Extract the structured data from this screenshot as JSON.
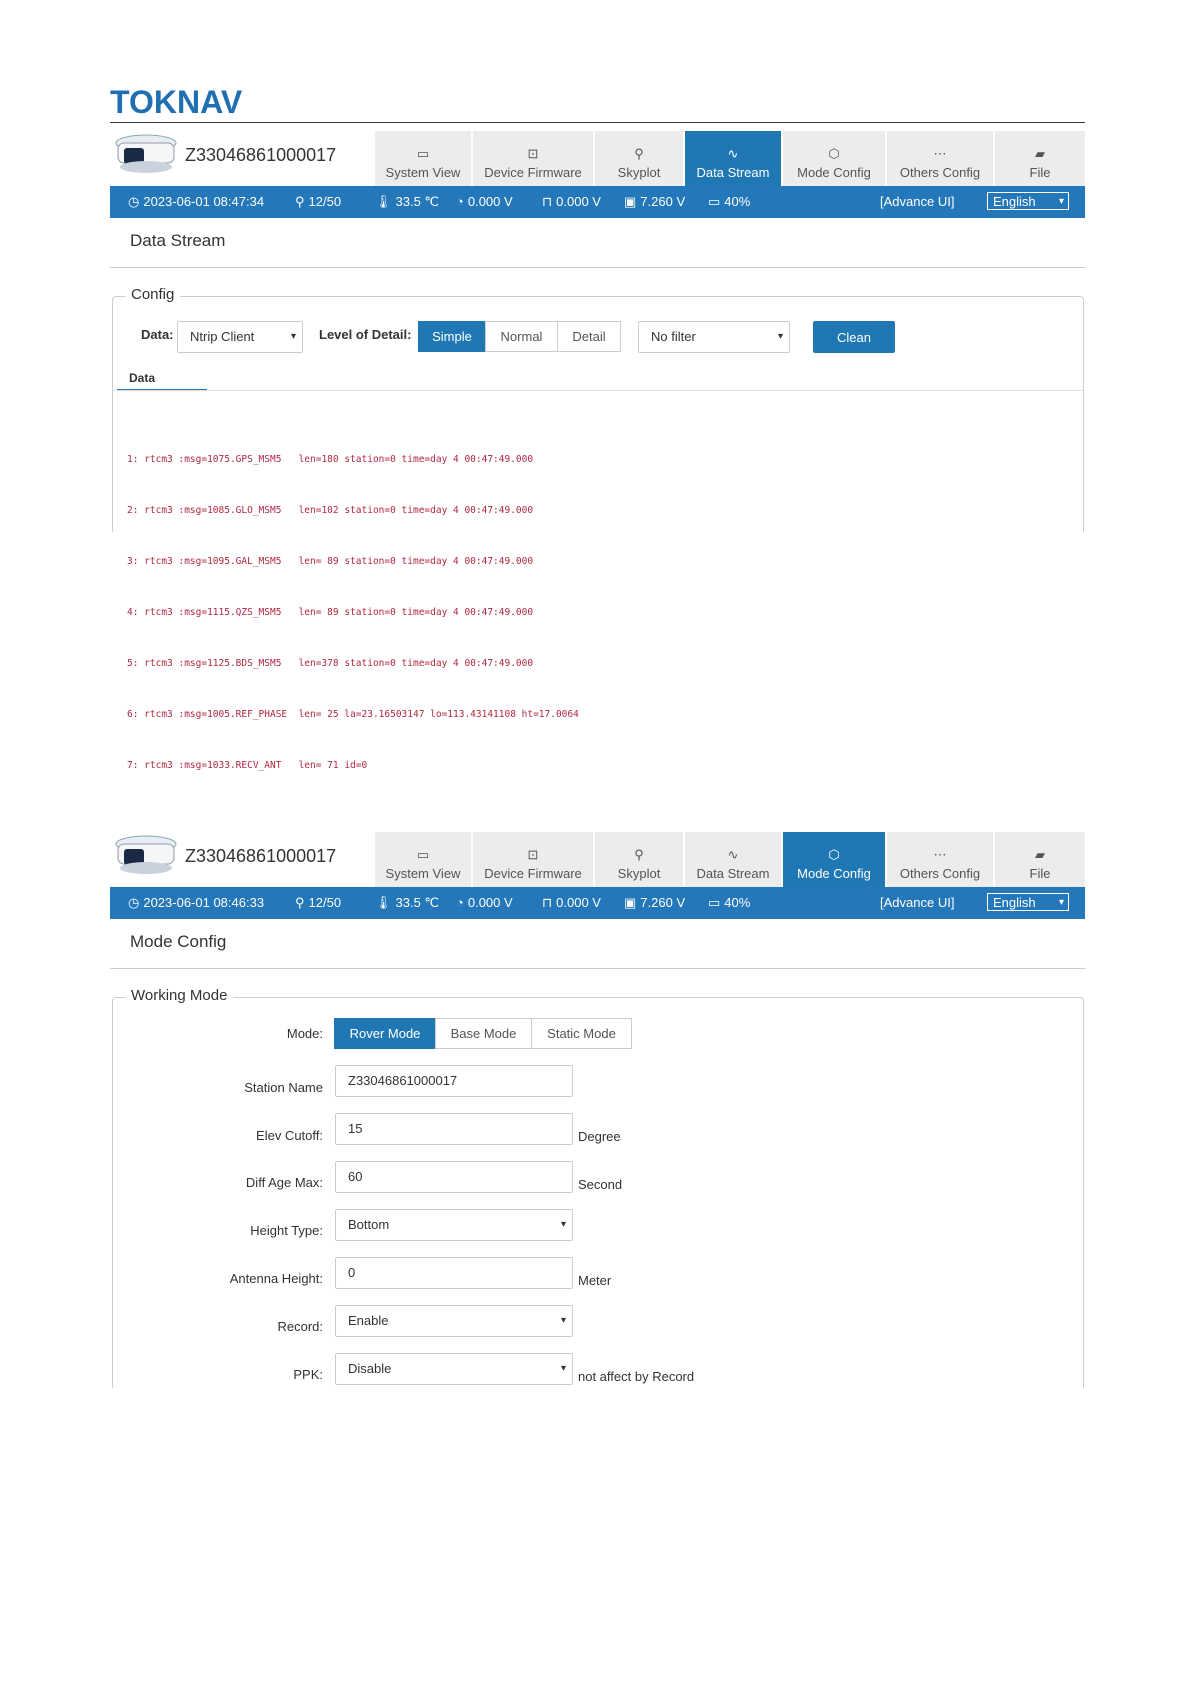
{
  "brand": {
    "logo_text": "TOKNAV"
  },
  "tab_icons": [
    "monitor-icon",
    "chip-icon",
    "satellite-icon",
    "wave-icon",
    "cube-icon",
    "ellipsis-icon",
    "folder-icon"
  ],
  "screens": [
    {
      "serial": "Z33046861000017",
      "tabs": [
        "System View",
        "Device Firmware",
        "Skyplot",
        "Data Stream",
        "Mode Config",
        "Others Config",
        "File"
      ],
      "active_tab": 3,
      "status": {
        "time": "2023-06-01 08:47:34",
        "sats": "12/50",
        "temp": "33.5 ℃",
        "v1": "0.000 V",
        "v2": "0.000 V",
        "v3": "7.260 V",
        "battery": "40%",
        "advance": "[Advance UI]",
        "language": "English"
      },
      "title": "Data Stream",
      "fieldset": "Config",
      "data_label": "Data:",
      "data_value": "Ntrip Client",
      "detail_label": "Level of Detail:",
      "detail_options": [
        "Simple",
        "Normal",
        "Detail"
      ],
      "detail_active": 0,
      "filter_value": "No filter",
      "clean_label": "Clean",
      "subtab": "Data",
      "log": [
        "1: rtcm3 :msg=1075.GPS_MSM5   len=180 station=0 time=day 4 00:47:49.000",
        "2: rtcm3 :msg=1085.GLO_MSM5   len=102 station=0 time=day 4 00:47:49.000",
        "3: rtcm3 :msg=1095.GAL_MSM5   len= 89 station=0 time=day 4 00:47:49.000",
        "4: rtcm3 :msg=1115.QZS_MSM5   len= 89 station=0 time=day 4 00:47:49.000",
        "5: rtcm3 :msg=1125.BDS_MSM5   len=378 station=0 time=day 4 00:47:49.000",
        "6: rtcm3 :msg=1005.REF_PHASE  len= 25 la=23.16503147 lo=113.43141108 ht=17.0064",
        "7: rtcm3 :msg=1033.RECV_ANT   len= 71 id=0"
      ]
    },
    {
      "serial": "Z33046861000017",
      "tabs": [
        "System View",
        "Device Firmware",
        "Skyplot",
        "Data Stream",
        "Mode Config",
        "Others Config",
        "File"
      ],
      "active_tab": 4,
      "status": {
        "time": "2023-06-01 08:46:33",
        "sats": "12/50",
        "temp": "33.5 ℃",
        "v1": "0.000 V",
        "v2": "0.000 V",
        "v3": "7.260 V",
        "battery": "40%",
        "advance": "[Advance UI]",
        "language": "English"
      },
      "title": "Mode Config",
      "fieldset": "Working Mode",
      "mode_label": "Mode:",
      "mode_options": [
        "Rover Mode",
        "Base Mode",
        "Static Mode"
      ],
      "mode_active": 0,
      "fields": [
        {
          "label": "Station Name",
          "value": "Z33046861000017",
          "kind": "input",
          "unit": ""
        },
        {
          "label": "Elev Cutoff:",
          "value": "15",
          "kind": "input",
          "unit": "Degree"
        },
        {
          "label": "Diff Age Max:",
          "value": "60",
          "kind": "input",
          "unit": "Second"
        },
        {
          "label": "Height Type:",
          "value": "Bottom",
          "kind": "select",
          "unit": ""
        },
        {
          "label": "Antenna Height:",
          "value": "0",
          "kind": "input",
          "unit": "Meter"
        },
        {
          "label": "Record:",
          "value": "Enable",
          "kind": "select",
          "unit": ""
        },
        {
          "label": "PPK:",
          "value": "Disable",
          "kind": "select",
          "unit": "not affect by Record"
        }
      ]
    }
  ]
}
